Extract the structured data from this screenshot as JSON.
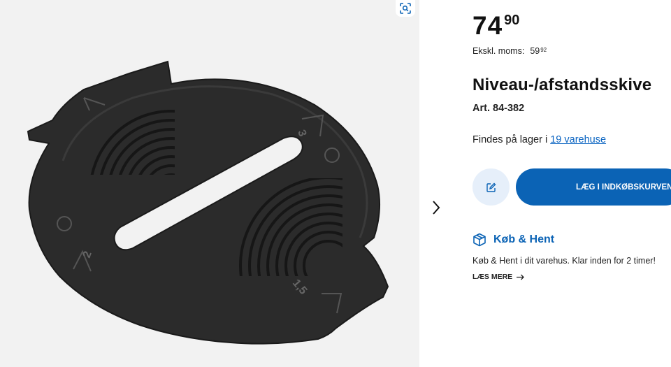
{
  "product": {
    "price_main": "74",
    "price_decimals": "90",
    "excl_label": "Ekskl. moms:",
    "excl_int": "59",
    "excl_dec": "92",
    "title": "Niveau-/afstandsskive",
    "article": "Art. 84-382",
    "image_markings": [
      "3",
      "2",
      "1,5"
    ]
  },
  "stock": {
    "prefix": "Findes på lager i ",
    "link_text": "19 varehuse"
  },
  "actions": {
    "add_to_cart": "LÆG I INDKØBSKURVEN"
  },
  "click_collect": {
    "title": "Køb & Hent",
    "text": "Køb & Hent i dit varehus. Klar inden for 2 timer!",
    "read_more": "LÆS MERE"
  },
  "icons": {
    "zoom": "zoom-scan-icon",
    "next": "chevron-right-icon",
    "edit": "edit-pencil-icon",
    "box": "package-box-icon",
    "arrow": "arrow-right-icon"
  },
  "colors": {
    "brand_blue": "#0b63b5",
    "link_blue": "#0a64c2",
    "edit_bg": "#e6effa",
    "gallery_bg": "#f2f2f2"
  }
}
